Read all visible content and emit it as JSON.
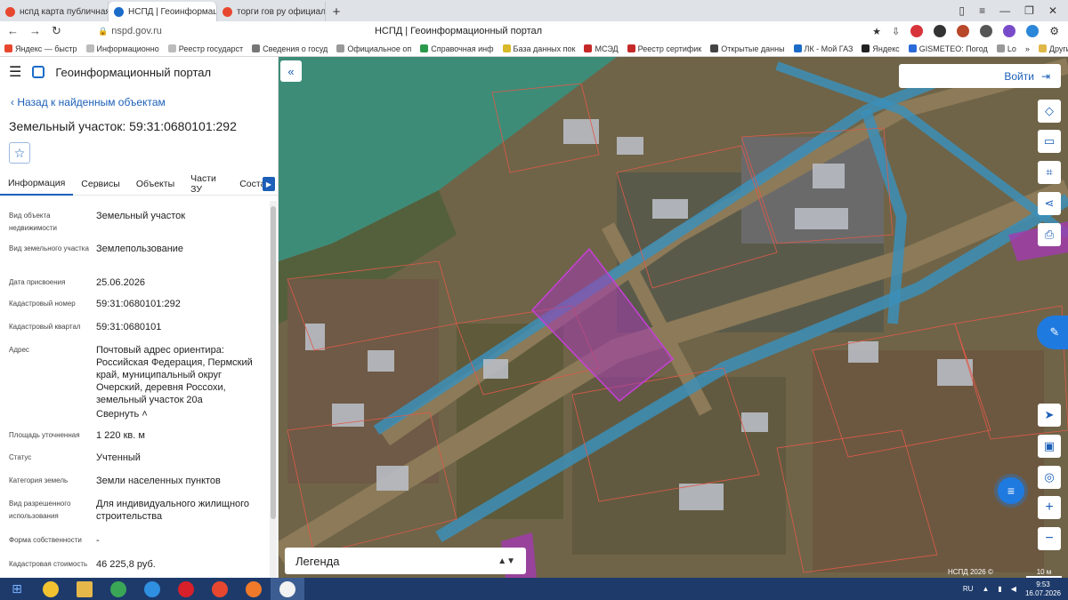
{
  "browser": {
    "tabs": [
      {
        "title": "нспд карта публичная кад",
        "color": "#e8472f",
        "active": false
      },
      {
        "title": "НСПД | Геоинформацио",
        "color": "#1b6cc9",
        "active": true
      },
      {
        "title": "торги гов ру официальн",
        "color": "#e8472f",
        "active": false
      }
    ],
    "url": "nspd.gov.ru",
    "page_title": "НСПД | Геоинформационный портал",
    "bookmarks": [
      "Яндекс — быстр",
      "Информационно",
      "Реестр государст",
      "Сведения о госуд",
      "Официальное оп",
      "Справочная инф",
      "База данных пок",
      "МСЭД",
      "Реестр сертифик",
      "Открытые данны",
      "ЛК - Мой ГАЗ",
      "Яндекс",
      "GISMETEO: Погод",
      "Lo"
    ],
    "bookmarks_more": "Другие закладки"
  },
  "portal": {
    "title": "Геоинформационный портал",
    "back_link": "Назад к найденным объектам",
    "object_title": "Земельный участок: 59:31:0680101:292",
    "tabs": [
      "Информация",
      "Сервисы",
      "Объекты",
      "Части ЗУ",
      "Состав"
    ],
    "fields": [
      {
        "label": "Вид объекта недвижимости",
        "value": "Земельный участок"
      },
      {
        "label": "Вид земельного участка",
        "value": "Землепользование"
      },
      {
        "label": "Дата присвоения",
        "value": "25.06.2026"
      },
      {
        "label": "Кадастровый номер",
        "value": "59:31:0680101:292"
      },
      {
        "label": "Кадастровый квартал",
        "value": "59:31:0680101"
      },
      {
        "label": "Адрес",
        "value": "Почтовый адрес ориентира: Российская Федерация, Пермский край, муниципальный округ Очерский, деревня Россохи, земельный участок 20а"
      },
      {
        "label": "Площадь уточненная",
        "value": "1 220 кв. м"
      },
      {
        "label": "Статус",
        "value": "Учтенный"
      },
      {
        "label": "Категория земель",
        "value": "Земли населенных пунктов"
      },
      {
        "label": "Вид разрешенного использования",
        "value": "Для индивидуального жилищного строительства"
      },
      {
        "label": "Форма собственности",
        "value": "-"
      },
      {
        "label": "Кадастровая стоимость",
        "value": "46 225,8 руб."
      }
    ],
    "collapse_link": "Свернуть"
  },
  "map": {
    "login": "Войти",
    "legend": "Легенда",
    "copyright": "НСПД 2026 ©",
    "scale": "10 м"
  },
  "taskbar": {
    "lang": "RU",
    "time": "9:53",
    "date": "16.07.2026"
  }
}
